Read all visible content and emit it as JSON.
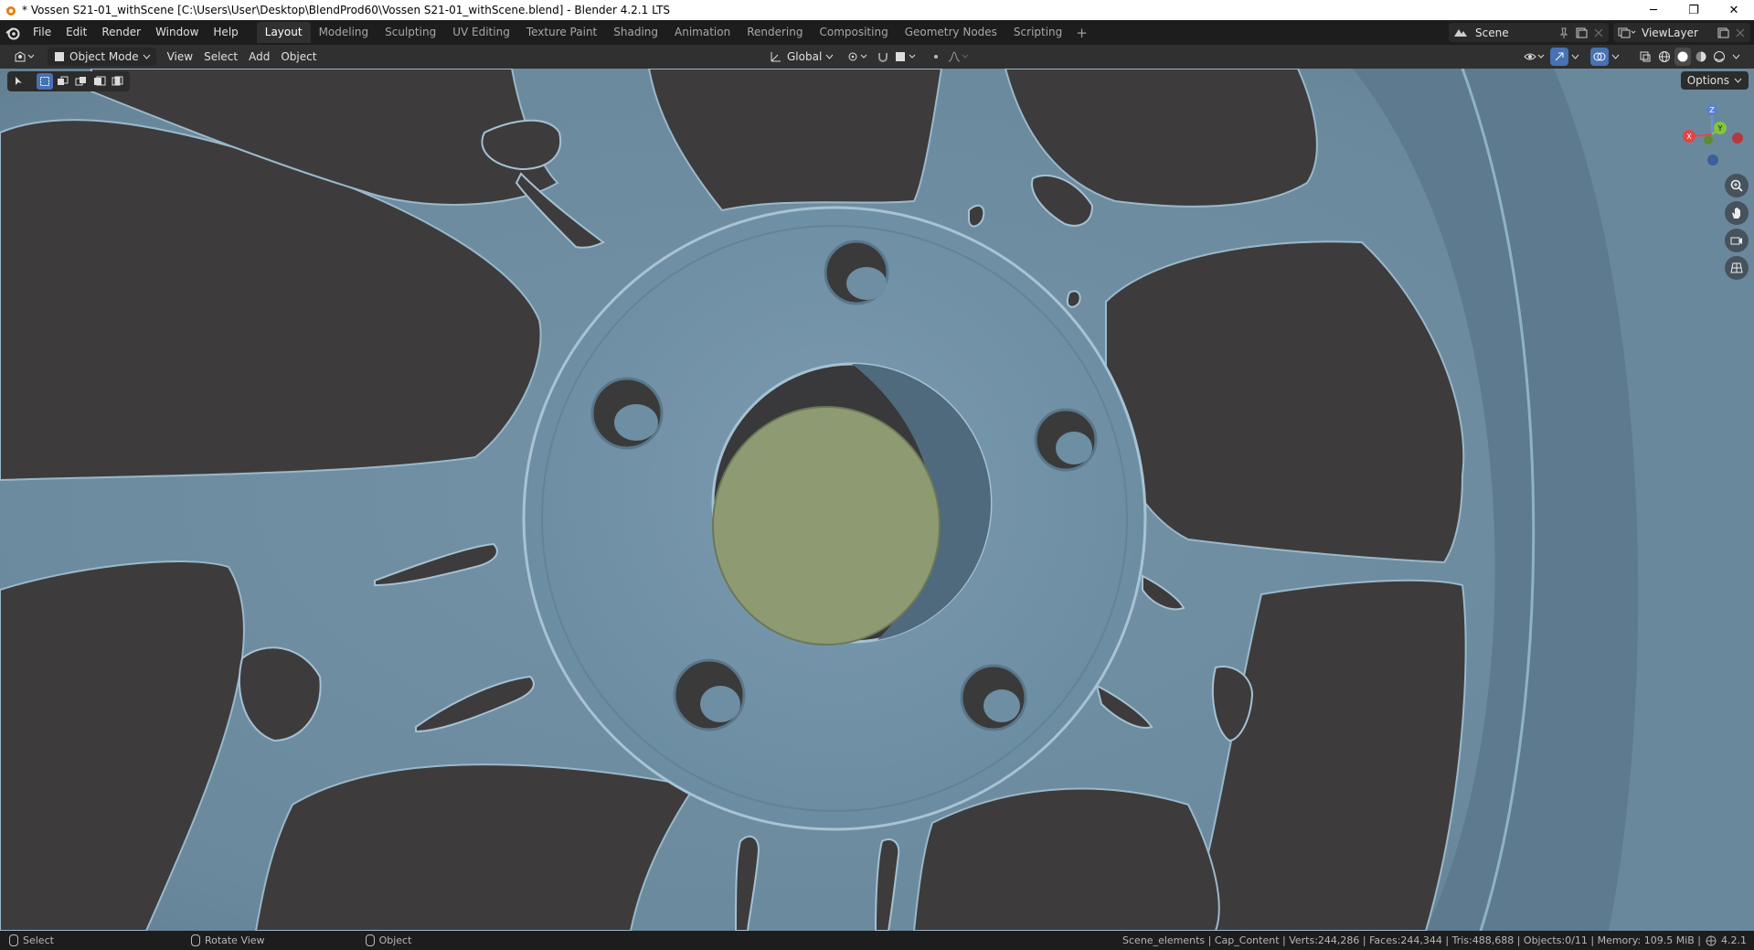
{
  "window": {
    "title": "* Vossen S21-01_withScene [C:\\Users\\User\\Desktop\\BlendProd60\\Vossen S21-01_withScene.blend] - Blender 4.2.1 LTS",
    "controls": [
      "─",
      "❐",
      "✕"
    ]
  },
  "menu": {
    "items": [
      "File",
      "Edit",
      "Render",
      "Window",
      "Help"
    ]
  },
  "workspaces": {
    "tabs": [
      "Layout",
      "Modeling",
      "Sculpting",
      "UV Editing",
      "Texture Paint",
      "Shading",
      "Animation",
      "Rendering",
      "Compositing",
      "Geometry Nodes",
      "Scripting"
    ],
    "active": "Layout",
    "add": "+"
  },
  "scene": {
    "name": "Scene"
  },
  "view_layer": {
    "name": "ViewLayer"
  },
  "viewport_header": {
    "mode": "Object Mode",
    "menus": [
      "View",
      "Select",
      "Add",
      "Object"
    ],
    "transform_orientation": "Global"
  },
  "viewport": {
    "options_label": "Options",
    "gizmo_axes": {
      "z": "Z",
      "y": "Y",
      "x": "X"
    },
    "colors": {
      "background": "#6c8a9e",
      "rim": "#7a97ab",
      "holes": "#3d3b3c",
      "cap": "#8e9a72"
    }
  },
  "statusbar": {
    "left": [
      "Select",
      "Rotate View",
      "Object"
    ],
    "stats": "Scene_elements | Cap_Content | Verts:244,286 | Faces:244,344 | Tris:488,688 | Objects:0/11 | Memory: 109.5 MiB | ",
    "version": "4.2.1"
  }
}
